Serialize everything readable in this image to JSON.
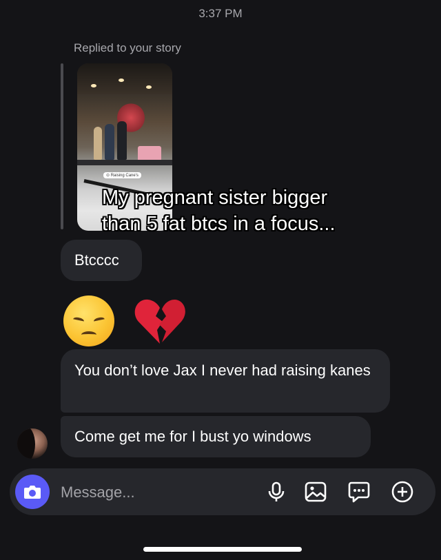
{
  "header": {
    "timestamp": "3:37 PM"
  },
  "story_reply": {
    "label": "Replied to your story",
    "location_tag": "Raising Cane's",
    "caption_line1": "My pregnant sister bigger",
    "caption_line2": "than 5 fat btcs in a focus..."
  },
  "messages": [
    {
      "type": "text",
      "text": "Btcccc"
    },
    {
      "type": "emoji",
      "icons": [
        "disappointed-face-emoji",
        "broken-heart-emoji"
      ]
    },
    {
      "type": "text",
      "text": "You don’t love Jax I never had raising kanes"
    },
    {
      "type": "text",
      "text": "Come get me for I bust yo windows"
    }
  ],
  "composer": {
    "placeholder": "Message...",
    "icons": [
      "camera-icon",
      "microphone-icon",
      "photo-icon",
      "sticker-icon",
      "plus-icon"
    ],
    "camera_color": "#5a5af6"
  }
}
